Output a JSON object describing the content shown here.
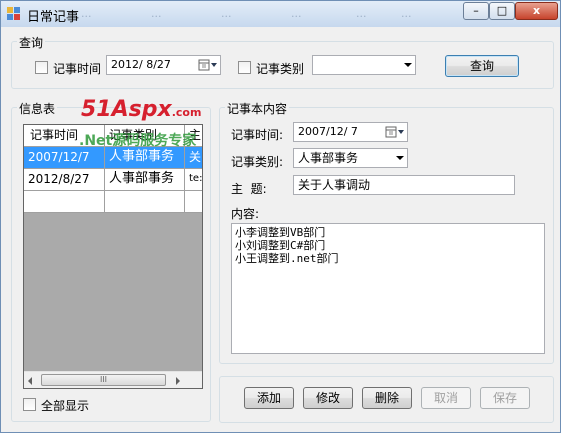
{
  "window": {
    "title": "日常记事",
    "ghost_menu": [
      "...",
      "...",
      "...",
      "...",
      "...",
      "..."
    ],
    "controls": {
      "minimize": "–",
      "maximize": "□",
      "close": "x"
    }
  },
  "query": {
    "group_label": "查询",
    "date_checkbox_label": "记事时间",
    "date_value": "2012/ 8/27",
    "category_checkbox_label": "记事类别",
    "category_value": "",
    "search_button": "查询"
  },
  "info_table": {
    "group_label": "信息表",
    "columns": [
      "记事时间",
      "记事类别",
      "主"
    ],
    "rows": [
      [
        "2007/12/7",
        "人事部事务",
        "关"
      ],
      [
        "2012/8/27",
        "人事部事务",
        "te:"
      ]
    ],
    "scroll_thumb_label": "III",
    "show_all_label": "全部显示"
  },
  "detail": {
    "group_label": "记事本内容",
    "date_label": "记事时间:",
    "date_value": "2007/12/ 7",
    "category_label": "记事类别:",
    "category_value": "人事部事务",
    "subject_label": "主  题:",
    "subject_value": "关于人事调动",
    "content_label": "内容:",
    "content_value": "小李调整到VB部门\n小刘调整到C#部门\n小王调整到.net部门"
  },
  "actions": {
    "add": "添加",
    "edit": "修改",
    "delete": "删除",
    "cancel": "取消",
    "save": "保存"
  },
  "watermark": {
    "line1": "51Aspx",
    "line1_suffix": ".com",
    "line2": ".Net源码服务专家"
  },
  "colors": {
    "selection": "#3399ff",
    "watermark_red": "#d6202e",
    "watermark_green": "#2e9a3a"
  }
}
